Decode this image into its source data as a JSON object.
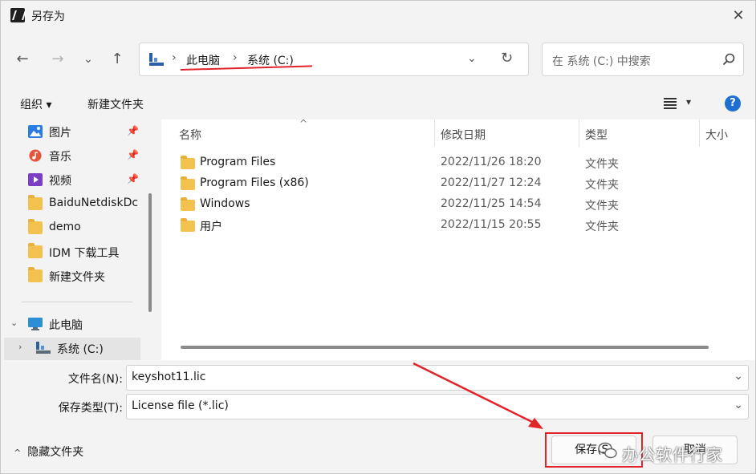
{
  "window": {
    "title": "另存为",
    "close_glyph": "✕"
  },
  "nav": {
    "back_glyph": "←",
    "forward_glyph": "→",
    "recent_glyph": "⌄",
    "up_glyph": "↑",
    "breadcrumb": [
      "此电脑",
      "系统 (C:)"
    ],
    "crumb_sep": "›",
    "dropdown_glyph": "⌄",
    "refresh_glyph": "↻",
    "search_placeholder": "在 系统 (C:) 中搜索"
  },
  "toolbar": {
    "organize_label": "组织 ▾",
    "new_folder_label": "新建文件夹",
    "view_dropdown_glyph": "▾",
    "help_glyph": "?"
  },
  "sidebar": {
    "items": [
      {
        "label": "图片",
        "pinned": true,
        "icon": "pictures-icon"
      },
      {
        "label": "音乐",
        "pinned": true,
        "icon": "music-icon"
      },
      {
        "label": "视频",
        "pinned": true,
        "icon": "video-icon"
      },
      {
        "label": "BaiduNetdiskDc",
        "pinned": false,
        "icon": "folder-icon"
      },
      {
        "label": "demo",
        "pinned": false,
        "icon": "folder-icon"
      },
      {
        "label": "IDM 下载工具",
        "pinned": false,
        "icon": "folder-icon"
      },
      {
        "label": "新建文件夹",
        "pinned": false,
        "icon": "folder-icon"
      }
    ],
    "this_pc": {
      "label": "此电脑",
      "chevron": "⌄"
    },
    "drive_c": {
      "label": "系统 (C:)",
      "chevron": "›"
    },
    "pin_glyph": "📌"
  },
  "files": {
    "columns": [
      "名称",
      "修改日期",
      "类型",
      "大小"
    ],
    "sort_glyph": "^",
    "rows": [
      {
        "name": "Program Files",
        "date": "2022/11/26 18:20",
        "type": "文件夹"
      },
      {
        "name": "Program Files (x86)",
        "date": "2022/11/27 12:24",
        "type": "文件夹"
      },
      {
        "name": "Windows",
        "date": "2022/11/25 14:54",
        "type": "文件夹"
      },
      {
        "name": "用户",
        "date": "2022/11/15 20:55",
        "type": "文件夹"
      }
    ]
  },
  "form": {
    "filename_label": "文件名(N):",
    "filename_value": "keyshot11.lic",
    "filetype_label": "保存类型(T):",
    "filetype_value": "License file (*.lic)",
    "dropdown_glyph": "⌄"
  },
  "footer": {
    "hide_folders_label": "隐藏文件夹",
    "hide_caret": "^",
    "save_label": "保存(S)",
    "cancel_label": "取消",
    "watermark_text": "办公软件行家"
  },
  "colors": {
    "accent": "#1f6fd0",
    "annotation_red": "#e0242a",
    "folder": "#f2c14e"
  }
}
